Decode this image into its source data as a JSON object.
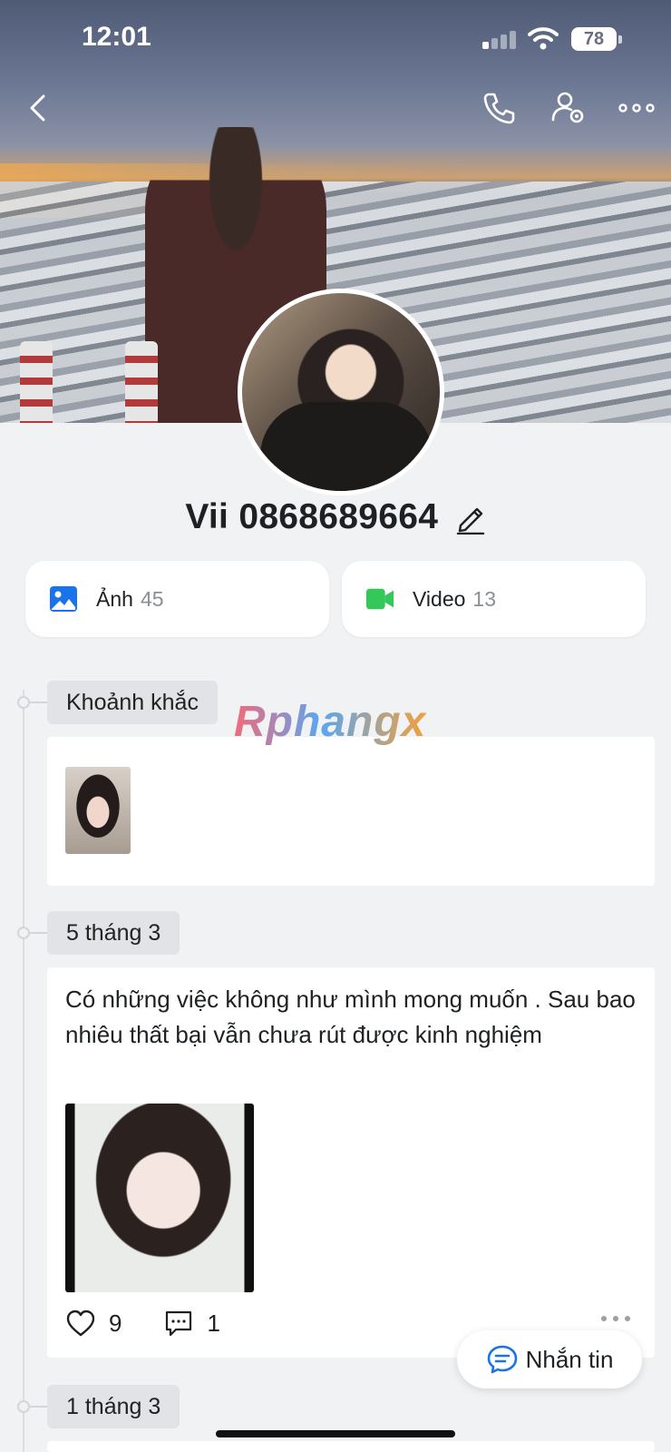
{
  "status_bar": {
    "time": "12:01",
    "battery": "78"
  },
  "profile": {
    "name": "Vii 0868689664"
  },
  "media": {
    "photos": {
      "label": "Ảnh",
      "count": "45"
    },
    "videos": {
      "label": "Video",
      "count": "13"
    }
  },
  "timeline": {
    "moments_label": "Khoảnh khắc",
    "posts": [
      {
        "date": "5 tháng 3",
        "text": "Có những việc không như mình mong muốn . Sau bao nhiêu thất bại vẫn chưa rút được kinh nghiệm",
        "likes": "9",
        "comments": "1"
      },
      {
        "date": "1 tháng 3"
      }
    ]
  },
  "message_button": {
    "label": "Nhắn tin"
  },
  "watermark": "Rphangx",
  "colors": {
    "accent": "#1a73e8",
    "video_green": "#34c759",
    "background": "#f1f2f4"
  }
}
